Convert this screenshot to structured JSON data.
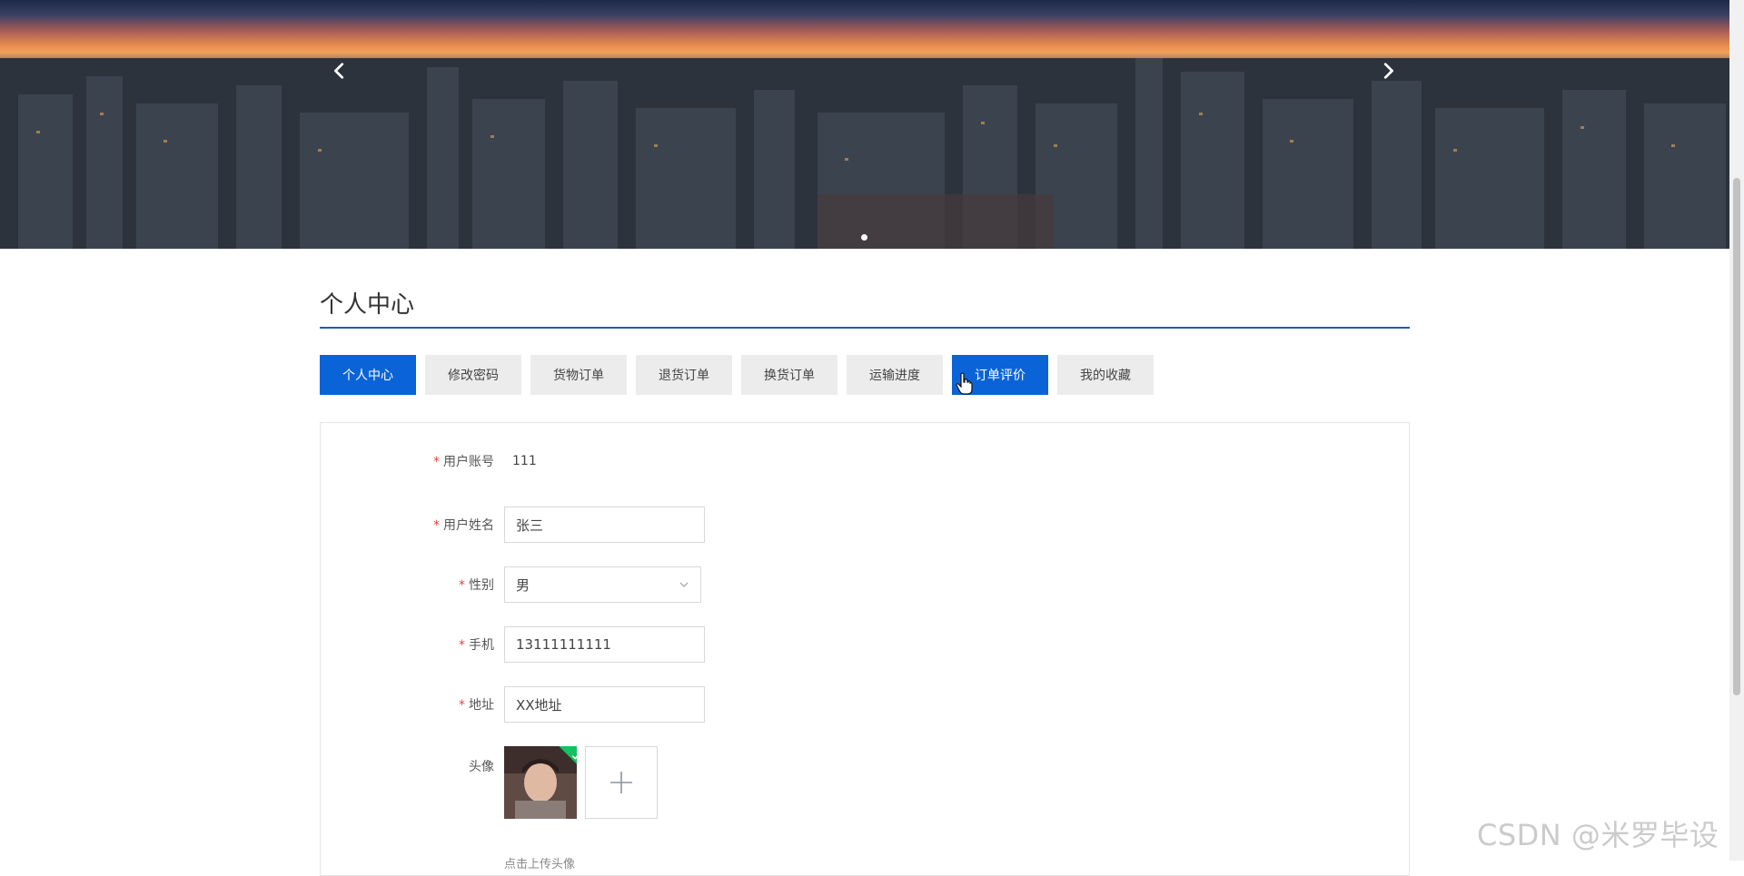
{
  "banner": {
    "prev_icon": "chevron-left-icon",
    "next_icon": "chevron-right-icon"
  },
  "page": {
    "title": "个人中心"
  },
  "tabs": [
    {
      "label": "个人中心",
      "active": true
    },
    {
      "label": "修改密码",
      "active": false
    },
    {
      "label": "货物订单",
      "active": false
    },
    {
      "label": "退货订单",
      "active": false
    },
    {
      "label": "换货订单",
      "active": false
    },
    {
      "label": "运输进度",
      "active": false
    },
    {
      "label": "订单评价",
      "active": true
    },
    {
      "label": "我的收藏",
      "active": false
    }
  ],
  "form": {
    "required_mark": "*",
    "account": {
      "label": "用户账号",
      "value": "111"
    },
    "name": {
      "label": "用户姓名",
      "value": "张三"
    },
    "gender": {
      "label": "性别",
      "value": "男"
    },
    "phone": {
      "label": "手机",
      "value": "13111111111"
    },
    "address": {
      "label": "地址",
      "value": "XX地址"
    },
    "avatar": {
      "label": "头像",
      "upload_icon": "plus-icon",
      "hint": "点击上传头像"
    }
  },
  "watermark": "CSDN @米罗毕设",
  "colors": {
    "primary": "#0a64d8",
    "title_rule": "#1f5fa8",
    "required": "#e0483f",
    "success": "#16c060"
  }
}
